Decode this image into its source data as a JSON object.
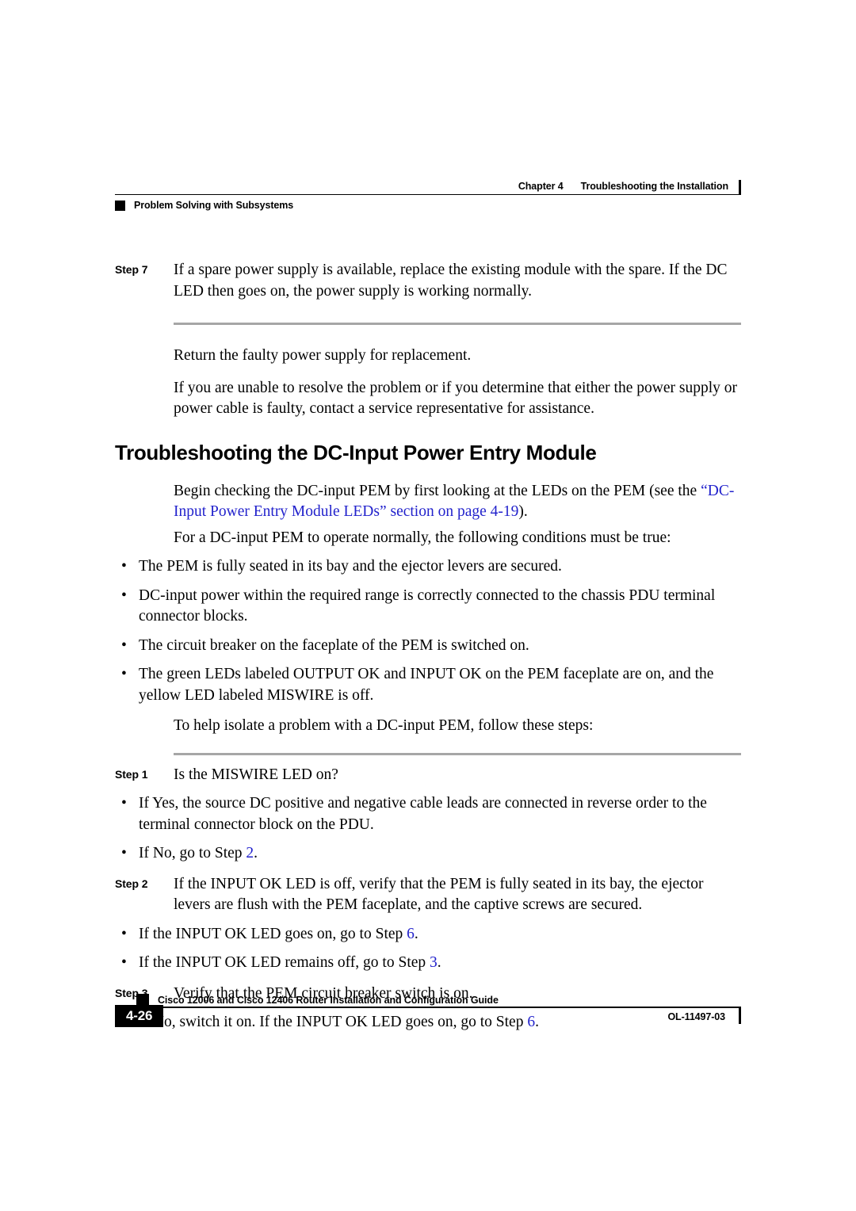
{
  "header": {
    "chapter": "Chapter 4",
    "chapter_title": "Troubleshooting the Installation",
    "section": "Problem Solving with Subsystems"
  },
  "footer": {
    "page_number": "4-26",
    "guide_title": "Cisco 12006 and Cisco 12406 Router Installation and Configuration Guide",
    "doc_id": "OL-11497-03"
  },
  "colors": {
    "link": "#2222cc",
    "rule": "#a6a6a6",
    "text": "#000000"
  },
  "content": {
    "step7": {
      "label": "Step 7",
      "text": "If a spare power supply is available, replace the existing module with the spare. If the DC LED then goes on, the power supply is working normally."
    },
    "para_return": "Return the faulty power supply for replacement.",
    "para_unable": "If you are unable to resolve the problem or if you determine that either the power supply or power cable is faulty, contact a service representative for assistance.",
    "section_heading": "Troubleshooting the DC-Input Power Entry Module",
    "para_begin_pre": "Begin checking the DC-input PEM by first looking at the LEDs on the PEM (see the ",
    "para_begin_link": "“DC-Input Power Entry Module LEDs” section on page 4-19",
    "para_begin_post": ").",
    "para_conditions": "For a DC-input PEM to operate normally, the following conditions must be true:",
    "conditions_bullets": [
      "The PEM is fully seated in its bay and the ejector levers are secured.",
      "DC-input power within the required range is correctly connected to the chassis PDU terminal connector blocks.",
      "The circuit breaker on the faceplate of the PEM is switched on.",
      "The green LEDs labeled OUTPUT OK and INPUT OK on the PEM faceplate are on, and the yellow LED labeled MISWIRE is off."
    ],
    "para_isolate": "To help isolate a problem with a DC-input PEM, follow these steps:",
    "step1": {
      "label": "Step 1",
      "text": "Is the MISWIRE LED on?",
      "bullets": [
        {
          "pre": "If Yes, the source DC positive and negative cable leads are connected in reverse order to the terminal connector block on the PDU.",
          "link": "",
          "post": ""
        },
        {
          "pre": "If No, go to Step ",
          "link": "2",
          "post": "."
        }
      ]
    },
    "step2": {
      "label": "Step 2",
      "text": "If the INPUT OK LED is off, verify that the PEM is fully seated in its bay, the ejector levers are flush with the PEM faceplate, and the captive screws are secured.",
      "bullets": [
        {
          "pre": "If the INPUT OK LED goes on, go to Step ",
          "link": "6",
          "post": "."
        },
        {
          "pre": "If the INPUT OK LED remains off, go to Step ",
          "link": "3",
          "post": "."
        }
      ]
    },
    "step3": {
      "label": "Step 3",
      "text": "Verify that the PEM circuit breaker switch is on.",
      "bullets": [
        {
          "pre": "If No, switch it on. If the INPUT OK LED goes on, go to Step ",
          "link": "6",
          "post": "."
        }
      ]
    },
    "bullet_glyph": "•"
  }
}
